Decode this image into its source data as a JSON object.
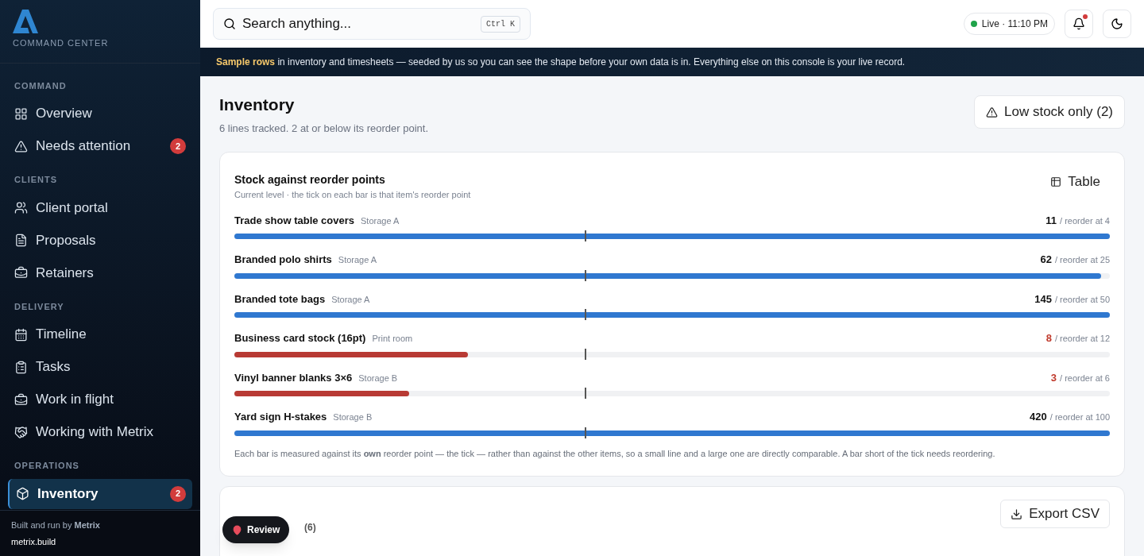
{
  "brand": {
    "subtitle": "COMMAND CENTER"
  },
  "sidebar": {
    "sections": [
      {
        "heading": "COMMAND",
        "items": [
          {
            "label": "Overview",
            "selected": false
          },
          {
            "label": "Needs attention",
            "badge": "2",
            "selected": false
          }
        ]
      },
      {
        "heading": "CLIENTS",
        "items": [
          {
            "label": "Client portal",
            "selected": false
          },
          {
            "label": "Proposals",
            "selected": false
          },
          {
            "label": "Retainers",
            "selected": false
          }
        ]
      },
      {
        "heading": "DELIVERY",
        "items": [
          {
            "label": "Timeline",
            "selected": false
          },
          {
            "label": "Tasks",
            "selected": false
          },
          {
            "label": "Work in flight",
            "selected": false
          },
          {
            "label": "Working with Metrix",
            "selected": false
          }
        ]
      },
      {
        "heading": "OPERATIONS",
        "items": [
          {
            "label": "Inventory",
            "badge": "2",
            "selected": true
          }
        ]
      }
    ],
    "footer": {
      "text": "Built and run by **Metrix**",
      "link": "metrix.build"
    }
  },
  "topbar": {
    "search": {
      "placeholder": "Search anything...",
      "shortcut": "Ctrl K"
    },
    "status": "Live · 11:10 PM",
    "notifications_unread": true
  },
  "banner": {
    "highlight": "Sample rows",
    "text": "in inventory and timesheets — seeded by us so you can see the shape before your own data is in. Everything else on this console is your live record."
  },
  "page": {
    "title": "Inventory",
    "subtitle": "6 lines tracked. 2 at or below its reorder point.",
    "filter_button": "Low stock only (2)"
  },
  "stock_card": {
    "title": "Stock against reorder points",
    "subtitle": "Current level · the tick on each bar is that item's reorder point",
    "view_button": "Table",
    "items": [
      {
        "name": "Trade show table covers",
        "location": "Storage A",
        "on_hand": "11",
        "reorder": "/ reorder at 4",
        "low": false,
        "level": 1
      },
      {
        "name": "Branded polo shirts",
        "location": "Storage A",
        "on_hand": "62",
        "reorder": "/ reorder at 25",
        "low": false,
        "level": 0.99
      },
      {
        "name": "Branded tote bags",
        "location": "Storage A",
        "on_hand": "145",
        "reorder": "/ reorder at 50",
        "low": false,
        "level": 1
      },
      {
        "name": "Business card stock (16pt)",
        "location": "Print room",
        "on_hand": "8",
        "reorder": "/ reorder at 12",
        "low": true,
        "level": 0.267
      },
      {
        "name": "Vinyl banner blanks 3×6",
        "location": "Storage B",
        "on_hand": "3",
        "reorder": "/ reorder at 6",
        "low": true,
        "level": 0.2
      },
      {
        "name": "Yard sign H-stakes",
        "location": "Storage B",
        "on_hand": "420",
        "reorder": "/ reorder at 100",
        "low": false,
        "level": 1
      }
    ],
    "note": "Each bar is measured against its **own** reorder point — the tick — rather than against the other items, so a small line and a large one are directly comparable. A bar short of the tick needs reordering."
  },
  "table_card": {
    "count": "(6)",
    "export_button": "Export CSV"
  },
  "review_button": "Review"
}
